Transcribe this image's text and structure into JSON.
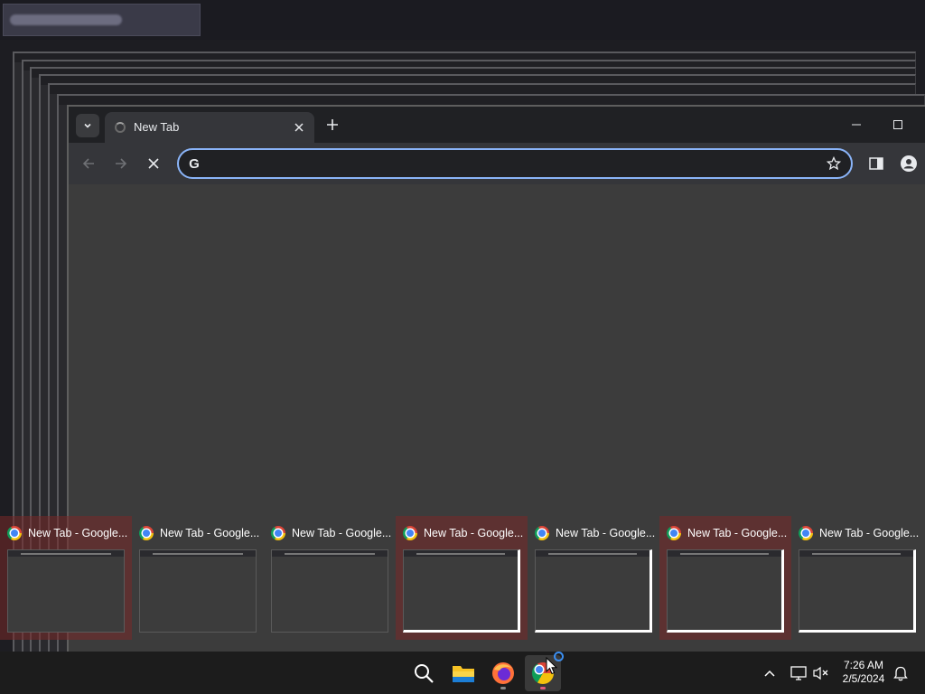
{
  "browser": {
    "tab_title": "New Tab",
    "omnibox_placeholder": ""
  },
  "thumbnails": [
    {
      "title": "New Tab - Google...",
      "highlighted": true,
      "selected": false
    },
    {
      "title": "New Tab - Google...",
      "highlighted": false,
      "selected": false
    },
    {
      "title": "New Tab - Google...",
      "highlighted": false,
      "selected": false
    },
    {
      "title": "New Tab - Google...",
      "highlighted": true,
      "selected": true
    },
    {
      "title": "New Tab - Google...",
      "highlighted": false,
      "selected": true
    },
    {
      "title": "New Tab - Google...",
      "highlighted": true,
      "selected": true
    },
    {
      "title": "New Tab - Google...",
      "highlighted": false,
      "selected": true
    }
  ],
  "taskbar": {
    "icons": [
      "search-icon",
      "file-explorer-icon",
      "firefox-icon",
      "chrome-icon"
    ],
    "time": "7:26 AM",
    "date": "2/5/2024"
  },
  "colors": {
    "accent": "#8ab4f8",
    "highlight": "#782828"
  }
}
